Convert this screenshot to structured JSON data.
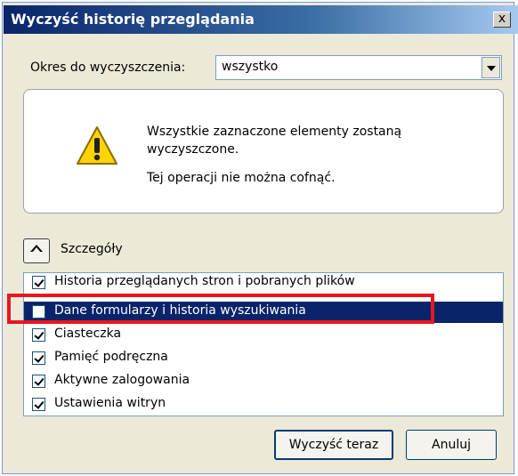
{
  "window": {
    "title": "Wyczyść historię przeglądania",
    "close_label": "x"
  },
  "period": {
    "label": "Okres do wyczyszczenia:",
    "selected_value": "wszystko"
  },
  "warning": {
    "line1": "Wszystkie zaznaczone elementy zostaną wyczyszczone.",
    "line2": "Tej operacji nie można cofnąć.",
    "icon": "warning-icon"
  },
  "details": {
    "label": "Szczegóły"
  },
  "items": [
    {
      "label": "Historia przeglądanych stron i pobranych plików",
      "checked": true,
      "selected": false
    },
    {
      "label": "Dane formularzy i historia wyszukiwania",
      "checked": false,
      "selected": true
    },
    {
      "label": "Ciasteczka",
      "checked": true,
      "selected": false
    },
    {
      "label": "Pamięć podręczna",
      "checked": true,
      "selected": false
    },
    {
      "label": "Aktywne zalogowania",
      "checked": true,
      "selected": false
    },
    {
      "label": "Ustawienia witryn",
      "checked": true,
      "selected": false
    }
  ],
  "buttons": {
    "clear_now": "Wyczyść teraz",
    "cancel": "Anuluj"
  },
  "colors": {
    "highlight": "#e8171e",
    "selection": "#0a246a",
    "warning_fill": "#ffd400"
  }
}
